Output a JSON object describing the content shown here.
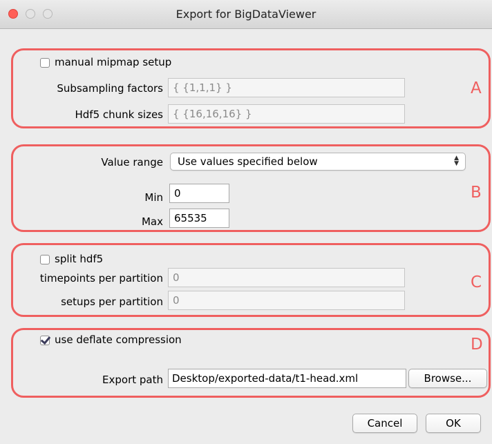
{
  "window": {
    "title": "Export for BigDataViewer"
  },
  "section_a": {
    "tag": "A",
    "manual_mipmap_label": "manual mipmap setup",
    "manual_mipmap_checked": false,
    "subsampling_label": "Subsampling factors",
    "subsampling_value": "{ {1,1,1} }",
    "chunk_label": "Hdf5 chunk sizes",
    "chunk_value": "{ {16,16,16} }"
  },
  "section_b": {
    "tag": "B",
    "value_range_label": "Value range",
    "value_range_selected": "Use values specified below",
    "min_label": "Min",
    "min_value": "0",
    "max_label": "Max",
    "max_value": "65535"
  },
  "section_c": {
    "tag": "C",
    "split_label": "split hdf5",
    "split_checked": false,
    "timepoints_label": "timepoints per partition",
    "timepoints_value": "0",
    "setups_label": "setups per partition",
    "setups_value": "0"
  },
  "section_d": {
    "tag": "D",
    "deflate_label": "use deflate compression",
    "deflate_checked": true,
    "export_path_label": "Export path",
    "export_path_value": "Desktop/exported-data/t1-head.xml",
    "browse_label": "Browse..."
  },
  "buttons": {
    "cancel": "Cancel",
    "ok": "OK"
  },
  "colors": {
    "annotation": "#ef5f5f",
    "close": "#ff5f57"
  }
}
